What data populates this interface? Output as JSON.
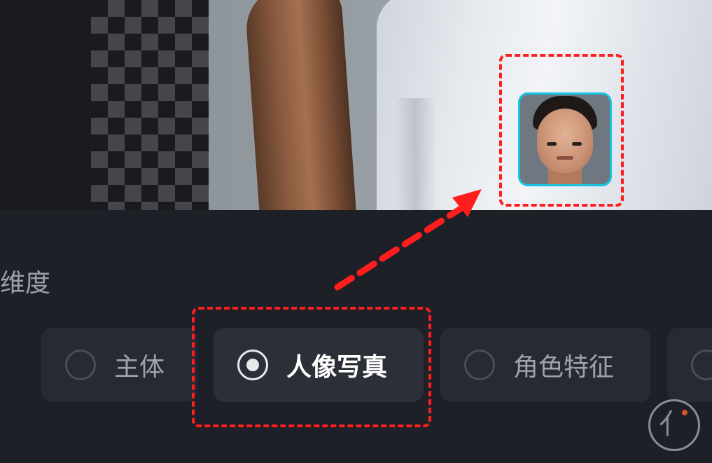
{
  "section_label": "维度",
  "options": [
    {
      "label": "主体",
      "selected": false
    },
    {
      "label": "人像写真",
      "selected": true
    },
    {
      "label": "角色特征",
      "selected": false
    }
  ],
  "colors": {
    "highlight_dash": "#ff1d1d",
    "face_frame": "#15c5e3",
    "background": "#1e2027",
    "option_bg": "#272a32"
  },
  "icons": {
    "watermark": "seal-icon",
    "arrow": "dashed-arrow-icon"
  }
}
